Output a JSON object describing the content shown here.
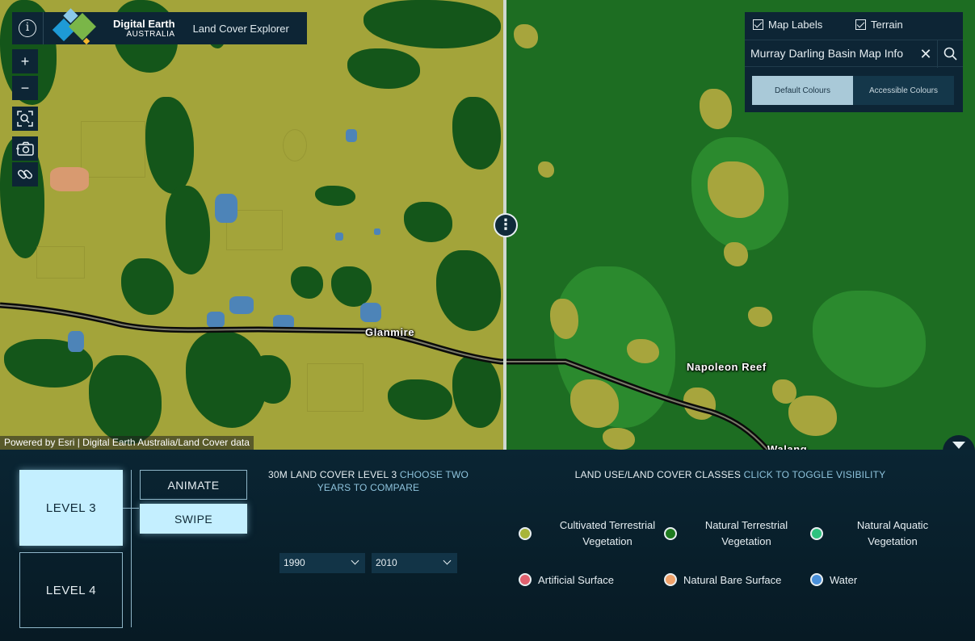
{
  "header": {
    "logo_title": "Digital Earth",
    "logo_subtitle": "AUSTRALIA",
    "app_title": "Land Cover Explorer",
    "info_icon": "i"
  },
  "map": {
    "attribution": "Powered by Esri | Digital Earth Australia/Land Cover data",
    "places": [
      "Glanmire",
      "Napoleon Reef",
      "Walang"
    ],
    "tools": {
      "zoom_in": "+",
      "zoom_out": "−"
    }
  },
  "layer_options": {
    "map_labels": "Map Labels",
    "terrain": "Terrain",
    "map_labels_checked": true,
    "terrain_checked": true
  },
  "search": {
    "value": "Murray Darling Basin Map Info",
    "clear_icon": "✕"
  },
  "colour_modes": {
    "default": "Default Colours",
    "accessible": "Accessible Colours",
    "selected": "Default Colours"
  },
  "levels": {
    "level3": "LEVEL 3",
    "level4": "LEVEL 4",
    "selected": "LEVEL 3"
  },
  "modes": {
    "animate": "ANIMATE",
    "swipe": "SWIPE",
    "selected": "SWIPE"
  },
  "compare": {
    "heading": "30M LAND COVER LEVEL 3",
    "hint": "CHOOSE TWO YEARS TO COMPARE",
    "year_left": "1990",
    "year_right": "2010"
  },
  "classes": {
    "heading": "LAND USE/LAND COVER CLASSES",
    "hint": "CLICK TO TOGGLE VISIBILITY",
    "items": [
      {
        "label1": "Cultivated Terrestrial",
        "label2": "Vegetation",
        "color": "#a8b53a"
      },
      {
        "label1": "Natural Terrestrial",
        "label2": "Vegetation",
        "color": "#1f7a1f"
      },
      {
        "label1": "Natural Aquatic",
        "label2": "Vegetation",
        "color": "#2ec27e"
      },
      {
        "label1": "Artificial Surface",
        "label2": "",
        "color": "#e0606e"
      },
      {
        "label1": "Natural Bare Surface",
        "label2": "",
        "color": "#f0a26a"
      },
      {
        "label1": "Water",
        "label2": "",
        "color": "#4a90d9"
      }
    ]
  }
}
